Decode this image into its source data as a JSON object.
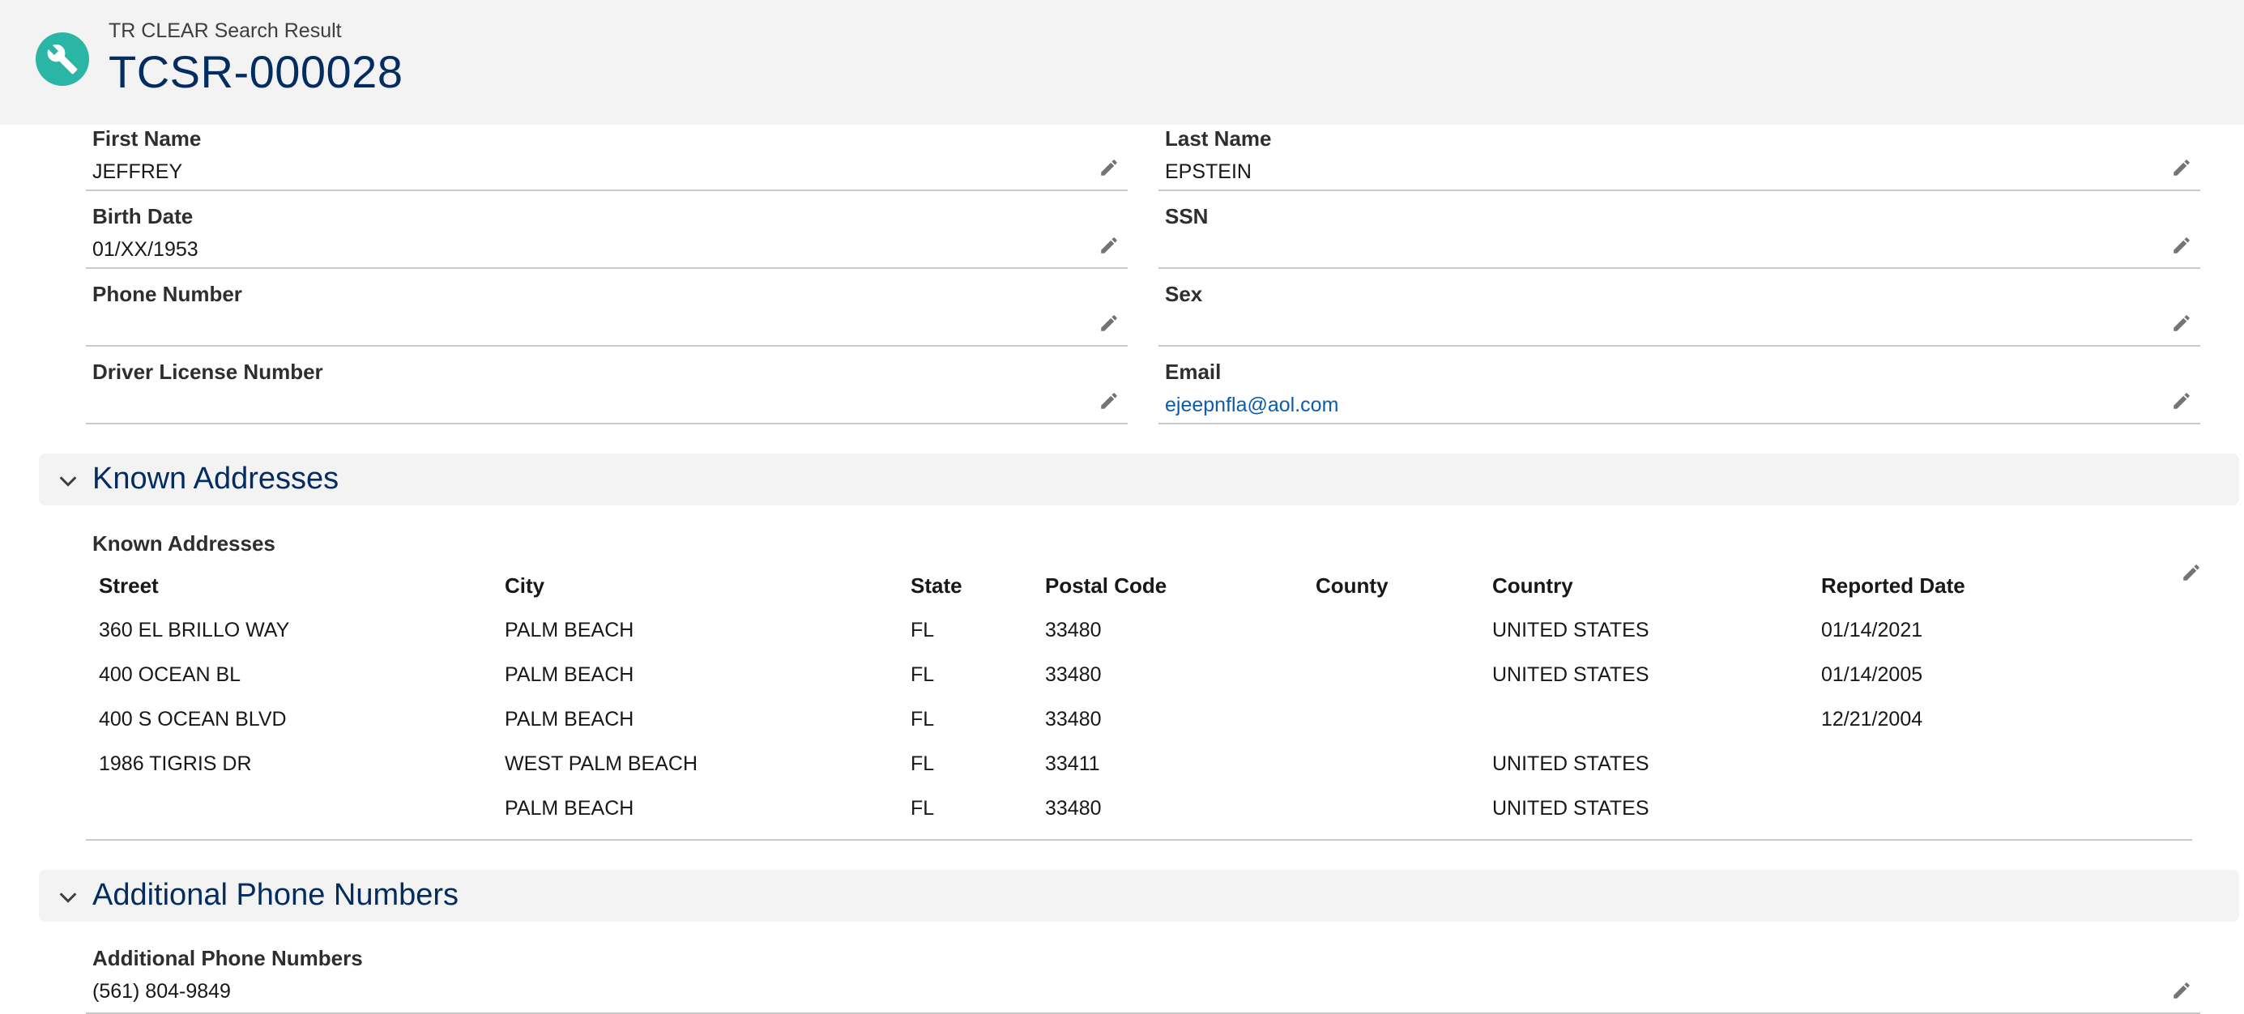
{
  "header": {
    "object_label": "TR CLEAR Search Result",
    "record_name": "TCSR-000028",
    "icon": "wrench-icon",
    "icon_color": "#2bb5a4"
  },
  "fields": {
    "first_name": {
      "label": "First Name",
      "value": "JEFFREY"
    },
    "last_name": {
      "label": "Last Name",
      "value": "EPSTEIN"
    },
    "birth_date": {
      "label": "Birth Date",
      "value": "01/XX/1953"
    },
    "ssn": {
      "label": "SSN",
      "value": ""
    },
    "phone_number": {
      "label": "Phone Number",
      "value": ""
    },
    "sex": {
      "label": "Sex",
      "value": ""
    },
    "driver_license": {
      "label": "Driver License Number",
      "value": ""
    },
    "email": {
      "label": "Email",
      "value": "ejeepnfla@aol.com"
    }
  },
  "known_addresses": {
    "section_title": "Known Addresses",
    "table_label": "Known Addresses",
    "columns": [
      "Street",
      "City",
      "State",
      "Postal Code",
      "County",
      "Country",
      "Reported Date"
    ],
    "rows": [
      [
        "360 EL BRILLO WAY",
        "PALM BEACH",
        "FL",
        "33480",
        "",
        "UNITED STATES",
        "01/14/2021"
      ],
      [
        "400 OCEAN BL",
        "PALM BEACH",
        "FL",
        "33480",
        "",
        "UNITED STATES",
        "01/14/2005"
      ],
      [
        "400 S OCEAN BLVD",
        "PALM BEACH",
        "FL",
        "33480",
        "",
        "",
        "12/21/2004"
      ],
      [
        "1986 TIGRIS DR",
        "WEST PALM BEACH",
        "FL",
        "33411",
        "",
        "UNITED STATES",
        ""
      ],
      [
        "",
        "PALM BEACH",
        "FL",
        "33480",
        "",
        "UNITED STATES",
        ""
      ]
    ]
  },
  "additional_phones": {
    "section_title": "Additional Phone Numbers",
    "label": "Additional Phone Numbers",
    "value": "(561) 804-9849"
  },
  "colors": {
    "title": "#032d60",
    "link": "#0b5cab",
    "header_bg": "#f3f3f3",
    "edit_icon": "#747474"
  }
}
